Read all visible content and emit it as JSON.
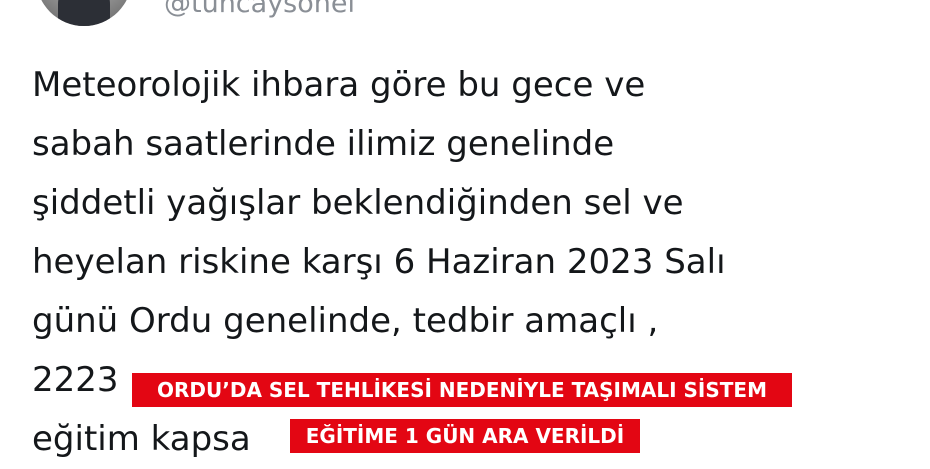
{
  "tweet": {
    "handle": "@tuncaysonel",
    "lines": [
      "Meteorolojik ihbara göre bu gece ve",
      "sabah saatlerinde ilimiz genelinde",
      "şiddetli yağışlar beklendiğinden sel ve",
      "heyelan riskine karşı 6 Haziran 2023 Salı",
      "günü Ordu genelinde, tedbir amaçlı ,",
      "2223",
      "eğitim kapsa"
    ]
  },
  "caption": {
    "line1": "ORDU’DA SEL TEHLİKESİ NEDENİYLE TAŞIMALI SİSTEM",
    "line2": "EĞİTİME 1 GÜN ARA VERİLDİ",
    "background": "#e30613",
    "text_color": "#ffffff"
  }
}
